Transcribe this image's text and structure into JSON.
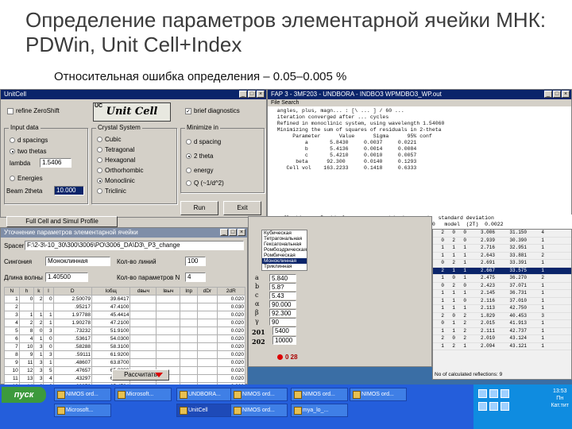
{
  "slide": {
    "title": "Определение параметров элементарной ячейки МНК: PDWin, Unit Cell+Index",
    "subtitle": "Относительная ошибка определения – 0.05–0.005 %"
  },
  "unitcell": {
    "title": "UnitCell",
    "refine_zeroshift": "refine ZeroShift",
    "logo": "Unit Cell",
    "uc": "UC",
    "brief_diagnostics": "brief diagnostics",
    "input_data_title": "Input data",
    "d_spacings": "d spacings",
    "two_theta": "two thetas",
    "lambda_label": "lambda",
    "lambda_value": "1.5406",
    "energies": "Energies",
    "beam_label": "Beam 2theta",
    "beam_value": "10.000",
    "crystal_title": "Crystal System",
    "systems": [
      "Cubic",
      "Tetragonal",
      "Hexagonal",
      "Orthorhombic",
      "Monoclinic",
      "Triclinic"
    ],
    "minimize_title": "Minimize in",
    "minimize": [
      "d spacing",
      "2 theta",
      "energy",
      "Q (~1/d^2)"
    ],
    "run_button": "Run",
    "exit_button": "Exit",
    "lower_button": "Full Cell and Simul Profile"
  },
  "editor": {
    "title": "FAP 3 - 3MF203 - UNDBORA - INDBO3 WPMDBO3_WP.out",
    "menu": "File  Search",
    "lines": [
      "  angles, plus, magn... : [\\ ... ] / 60 ... ",
      "  iteration converged after ... cycles",
      "",
      "  Refined in monoclinic system, using wavelength 1.54060",
      "  Minimizing the sum of squares of residuals in 2-theta",
      "",
      "",
      "       Parameter      Value      Sigma      95% conf",
      "",
      "           a       5.8430     0.0037     0.0221",
      "           b       5.4136     0.0014     0.0084",
      "           c       5.4210     0.0010     0.0057",
      "        beta      92.300      0.0140     0.1293",
      "     Cell vol    163.2233     0.1418     0.6333"
    ],
    "out_lines": [
      "  reflections   Residuals   average, std. dev.  and   standard deviation",
      "  ez (2T)  -0.0031    -0.0011    -0.0045      0.00000   model  (2T)  0.0022"
    ]
  },
  "index_dialog": {
    "title": "Уточнение параметров элементарной ячейки",
    "path_label": "Spacer",
    "path_value": "F:\\2-3\\-10_30\\300\\3006\\PO\\3006_DA\\D3\\_P3_change",
    "system_label": "Сингония",
    "system_value": "Моноклинная",
    "count_label": "Кол-во линий",
    "count_value": "100",
    "wavelength_label": "Длина волны",
    "wavelength_value": "1.40500",
    "params_label": "Кол-во параметров N",
    "params_value": "4",
    "columns": [
      "N",
      "h",
      "k",
      "l",
      "D",
      "Iобщ",
      "dвыч",
      "Iвыч",
      "Iпр",
      "dDr",
      "2dR"
    ],
    "rows": [
      [
        "1",
        "0",
        "2",
        "0",
        "2.50079",
        "39.6417",
        "",
        "",
        "",
        "",
        "0.020"
      ],
      [
        "2",
        "",
        "",
        "",
        ".95217",
        "47.4100",
        "",
        "",
        "",
        "",
        "0.030"
      ],
      [
        "3",
        "1",
        "1",
        "1",
        "1.97788",
        "45.4414",
        "",
        "",
        "",
        "",
        "0.020"
      ],
      [
        "4",
        "2",
        "2",
        "1",
        "1.90278",
        "47.2100",
        "",
        "",
        "",
        "",
        "0.020"
      ],
      [
        "5",
        "8",
        "0",
        "3",
        ".73232",
        "51.9100",
        "",
        "",
        "",
        "",
        "0.020"
      ],
      [
        "6",
        "4",
        "1",
        "0",
        ".53617",
        "54.0300",
        "",
        "",
        "",
        "",
        "0.020"
      ],
      [
        "7",
        "10",
        "3",
        "0",
        ".58288",
        "58.3100",
        "",
        "",
        "",
        "",
        "0.020"
      ],
      [
        "8",
        "9",
        "1",
        "3",
        ".59111",
        "61.9200",
        "",
        "",
        "",
        "",
        "0.020"
      ],
      [
        "9",
        "11",
        "3",
        "1",
        ".48607",
        "63.8700",
        "",
        "",
        "",
        "",
        "0.020"
      ],
      [
        "10",
        "12",
        "3",
        "5",
        ".47657",
        "65.8800",
        "",
        "",
        "",
        "",
        "0.020"
      ],
      [
        "11",
        "13",
        "3",
        "4",
        ".43297",
        "63.2600",
        "",
        "",
        "",
        "",
        "0.020"
      ],
      [
        "12",
        "14",
        "2",
        "2",
        ".39252",
        "65.4724",
        "",
        "",
        "",
        "",
        "0.020"
      ]
    ],
    "calc_button": "Рассчитать"
  },
  "params_panel": {
    "list": [
      "Кубическая",
      "Тетрагональная",
      "Гексагональная",
      "Ромбоэдрическая",
      "Ромбическая",
      "Моноклинная",
      "Триклинная"
    ],
    "labels": [
      "a",
      "b",
      "c",
      "α",
      "β",
      "γ"
    ],
    "values": [
      "5.840",
      "5.8?",
      "5.43",
      "90.000",
      "92.300",
      "90"
    ],
    "count_labels": [
      "201",
      "202"
    ],
    "count_values": [
      "5400",
      "10000"
    ],
    "status": "0     28"
  },
  "reflections": {
    "rows": [
      [
        "2",
        "0",
        "0",
        "3.006",
        "31.150",
        "4"
      ],
      [
        "0",
        "2",
        "0",
        "2.939",
        "30.390",
        "1"
      ],
      [
        "1",
        "1",
        "1",
        "2.716",
        "32.951",
        "1"
      ],
      [
        "1",
        "1",
        "1",
        "2.643",
        "33.881",
        "2"
      ],
      [
        "0",
        "2",
        "1",
        "2.691",
        "33.391",
        "1"
      ],
      [
        "2",
        "1",
        "1",
        "2.667",
        "33.575",
        "1"
      ],
      [
        "1",
        "0",
        "1",
        "2.475",
        "36.270",
        "2"
      ],
      [
        "0",
        "2",
        "0",
        "2.423",
        "37.071",
        "1"
      ],
      [
        "1",
        "1",
        "1",
        "2.145",
        "36.731",
        "1"
      ],
      [
        "1",
        "1",
        "0",
        "2.116",
        "37.010",
        "1"
      ],
      [
        "1",
        "1",
        "1",
        "2.113",
        "42.750",
        "1"
      ],
      [
        "2",
        "0",
        "2",
        "1.829",
        "40.453",
        "3"
      ],
      [
        "0",
        "1",
        "2",
        "2.015",
        "41.913",
        "1"
      ],
      [
        "1",
        "1",
        "2",
        "2.111",
        "42.737",
        "1"
      ],
      [
        "2",
        "0",
        "2",
        "2.010",
        "43.124",
        "1"
      ],
      [
        "1",
        "2",
        "1",
        "2.094",
        "43.121",
        "1"
      ]
    ],
    "footer": "No of calculated reflections: 9",
    "selected_index": 5
  },
  "taskbar": {
    "start": "пуск",
    "tasks": [
      "NIMOS ord...",
      "Microsoft...",
      "UNDBORA...",
      "NIMOS ord...",
      "NIMOS ord...",
      "NIMOS ord...",
      "",
      "Microsoft...",
      "UnitCell",
      "NIMOS ord...",
      "mya_lo_..."
    ],
    "clock_lines": [
      "13:53",
      "Пн",
      "Кат.тит"
    ]
  },
  "colors": {
    "desktop": "#3a6ea5",
    "titlebar": "#0a246a",
    "taskbar": "#245edb",
    "window": "#d4d0c8"
  }
}
